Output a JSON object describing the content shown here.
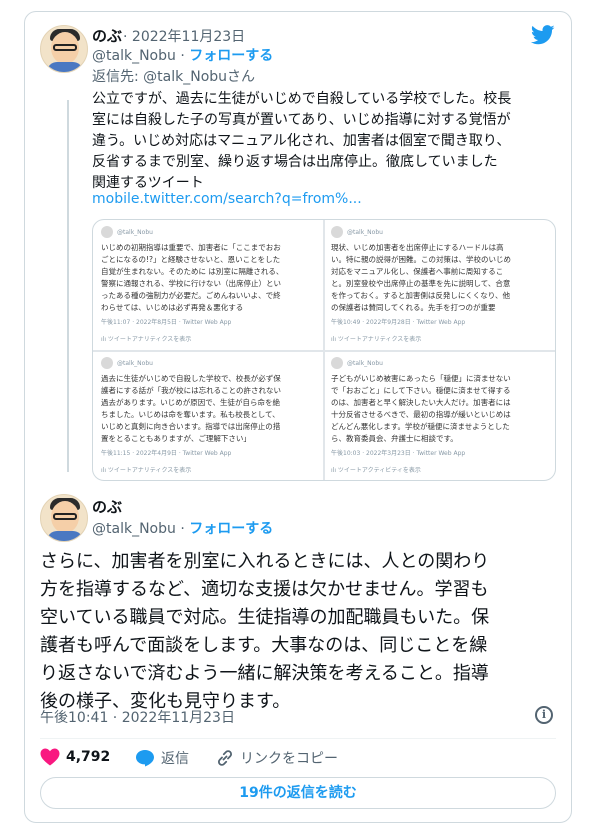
{
  "tweet1": {
    "name": "のぶ",
    "date": "2022年11月23日",
    "handle": "@talk_Nobu",
    "follow_label": "フォローする",
    "reply_to": "返信先: @talk_Nobuさん",
    "text_lines": [
      "公立ですが、過去に生徒がいじめで自殺している学校でした。校長",
      "室には自殺した子の写真が置いてあり、いじめ指導に対する覚悟が",
      "違う。いじめ対応はマニュアル化され、加害者は個室で聞き取り、",
      "反省するまで別室、繰り返す場合は出席停止。徹底していました",
      "関連するツイート"
    ],
    "link": "mobile.twitter.com/search?q=from%...",
    "embedded": [
      {
        "handle": "@talk_Nobu",
        "lines": [
          "いじめの初期指導は重要で、加害者に「ここまでおお",
          "ごとになるの!?」と経験させないと、恩いことをした",
          "自覚が生まれない。そのために は別室に隔離される、",
          "警察に通報される、学校に行けない（出席停止）とい",
          "ったある種の強制力が必要だ。ごめんねいいよ、で終",
          "わらせては、いじめは必ず再発＆悪化する"
        ],
        "time": "午後11:07 · 2022年8月5日 · Twitter Web App",
        "analytics": "ツイートアナリティクスを表示"
      },
      {
        "handle": "@talk_Nobu",
        "lines": [
          "現状、いじめ加害者を出席停止にするハードルは高",
          "い。特に親の説得が困難。この対策は、学校のいじめ",
          "対応をマニュアル化し、保護者へ事前に周知するこ",
          "と。別室登校や出席停止の基準を先に説明して、合意",
          "を作っておく。すると加害側は反発しにくくなり、他",
          "の保護者は賛同してくれる。先手を打つのが重要"
        ],
        "time": "午後10:49 · 2022年9月28日 · Twitter Web App",
        "analytics": "ツイートアナリティクスを表示"
      },
      {
        "handle": "@talk_Nobu",
        "lines": [
          "過去に生徒がいじめで自殺した学校で、校長が必ず保",
          "護者にする話が「我が校には忘れることの許されない",
          "過去があります。いじめが原因で、生徒が自ら命を絶",
          "ちました。いじめは命を奪います。私も校長として、",
          "いじめと真剣に向き合います。指導では出席停止の措",
          "置をとることもありますが、ご理解下さい」"
        ],
        "time": "午後11:15 · 2022年4月9日 · Twitter Web App",
        "analytics": "ツイートアナリティクスを表示"
      },
      {
        "handle": "@talk_Nobu",
        "lines": [
          "子どもがいじめ被害にあったら「穏便」に済ませない",
          "で「おおごと」にして下さい。穏便に済ませて得する",
          "のは、加害者と早く解決したい大人だけ。加害者には",
          "十分反省させるべきで、最初の指導が緩いといじめは",
          "どんどん悪化します。学校が穏便に済ませようとした",
          "ら、教育委員会、弁護士に相談です。"
        ],
        "time": "午後10:03 · 2022年3月23日 · Twitter Web App",
        "analytics": "ツイートアクティビティを表示"
      }
    ]
  },
  "tweet2": {
    "name": "のぶ",
    "handle": "@talk_Nobu",
    "follow_label": "フォローする",
    "text_lines": [
      "さらに、加害者を別室に入れるときには、人との関わり",
      "方を指導するなど、適切な支援は欠かせません。学習も",
      "空いている職員で対応。生徒指導の加配職員もいた。保",
      "護者も呼んで面談をします。大事なのは、同じことを繰",
      "り返さないで済むよう一緒に解決策を考えること。指導",
      "後の様子、変化も見守ります。"
    ],
    "timestamp": "午後10:41 · 2022年11月23日"
  },
  "actions": {
    "like_count": "4,792",
    "reply_label": "返信",
    "copy_link_label": "リンクをコピー"
  },
  "read_replies_label": "19件の返信を読む",
  "colors": {
    "accent": "#1d9bf0",
    "like": "#f91880",
    "text": "#0f1419",
    "muted": "#536471"
  }
}
